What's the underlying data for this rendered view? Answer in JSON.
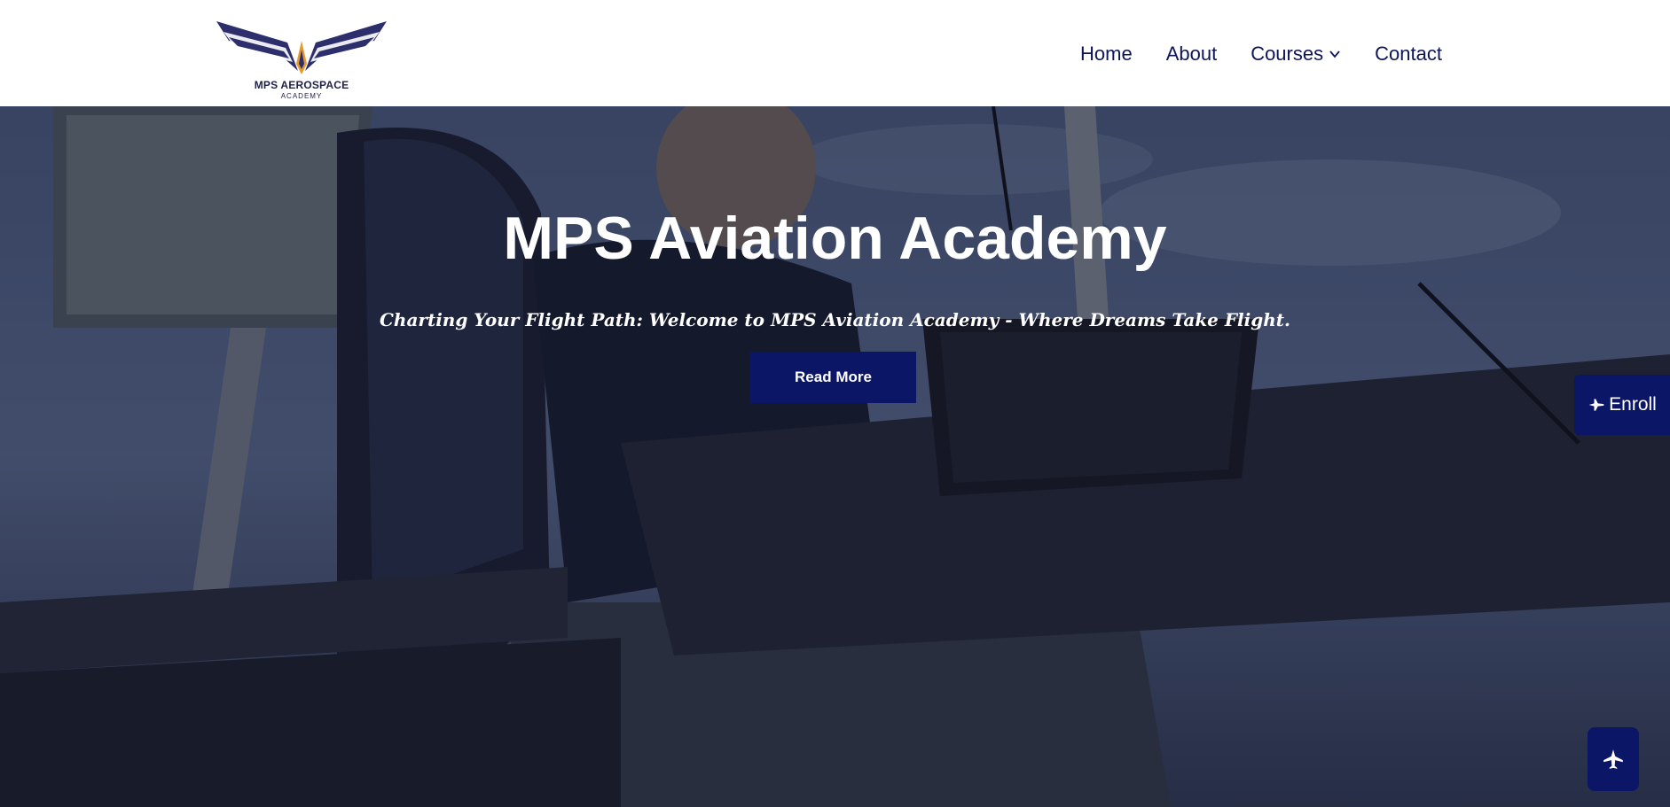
{
  "header": {
    "logo_title": "MPS AEROSPACE",
    "logo_subtitle": "ACADEMY",
    "nav": [
      {
        "label": "Home"
      },
      {
        "label": "About"
      },
      {
        "label": "Courses"
      },
      {
        "label": "Contact"
      }
    ]
  },
  "hero": {
    "title": "MPS Aviation Academy",
    "subtitle": "Charting Your Flight Path: Welcome to MPS Aviation Academy - Where Dreams Take Flight.",
    "button_label": "Read More"
  },
  "enroll": {
    "label": "Enroll",
    "icon": "airplane-icon"
  },
  "scroll_top": {
    "icon": "airplane-icon"
  },
  "colors": {
    "brand_navy": "#0c1667",
    "nav_text": "#0d1559",
    "logo_wing": "#2c2f6b",
    "logo_accent": "#e59a2f"
  }
}
